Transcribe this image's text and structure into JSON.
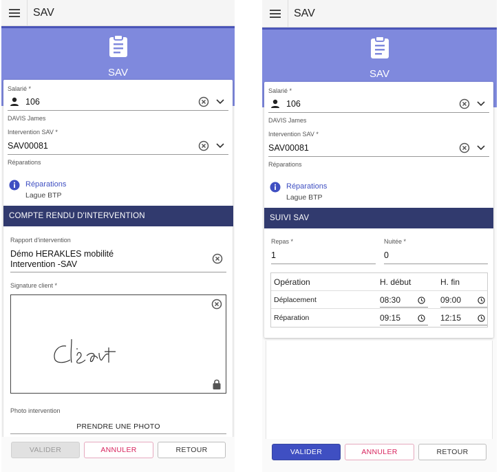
{
  "app": {
    "title": "SAV",
    "banner_title": "SAV"
  },
  "colors": {
    "banner": "#7f89dd",
    "section_header": "#313a6e",
    "primary": "#3f4fc2",
    "danger": "#d8245e",
    "info": "#3f4fc2"
  },
  "left": {
    "salarie": {
      "label": "Salarié *",
      "value": "106",
      "sub": "DAVIS James"
    },
    "intervention": {
      "label": "Intervention SAV *",
      "value": "SAV00081",
      "sub": "Réparations"
    },
    "info": {
      "title": "Réparations",
      "subtitle": "Lague BTP"
    },
    "section_title": "COMPTE RENDU D'INTERVENTION",
    "rapport": {
      "label": "Rapport d'intervention",
      "line1": "Démo HERAKLES mobilité",
      "line2": "Intervention -SAV"
    },
    "signature": {
      "label": "Signature client *",
      "handwriting": "client"
    },
    "photo": {
      "label": "Photo intervention",
      "button": "PRENDRE UNE PHOTO"
    },
    "buttons": {
      "validate": "VALIDER",
      "cancel": "ANNULER",
      "back": "RETOUR"
    }
  },
  "right": {
    "salarie": {
      "label": "Salarié *",
      "value": "106",
      "sub": "DAVIS James"
    },
    "intervention": {
      "label": "Intervention SAV *",
      "value": "SAV00081",
      "sub": "Réparations"
    },
    "info": {
      "title": "Réparations",
      "subtitle": "Lague BTP"
    },
    "section_title": "SUIVI SAV",
    "repas": {
      "label": "Repas *",
      "value": "1"
    },
    "nuitee": {
      "label": "Nuitée *",
      "value": "0"
    },
    "table": {
      "headers": [
        "Opération",
        "H. début",
        "H. fin"
      ],
      "rows": [
        {
          "operation": "Déplacement",
          "start": "08:30",
          "end": "09:00"
        },
        {
          "operation": "Réparation",
          "start": "09:15",
          "end": "12:15"
        }
      ]
    },
    "buttons": {
      "validate": "VALIDER",
      "cancel": "ANNULER",
      "back": "RETOUR"
    }
  }
}
